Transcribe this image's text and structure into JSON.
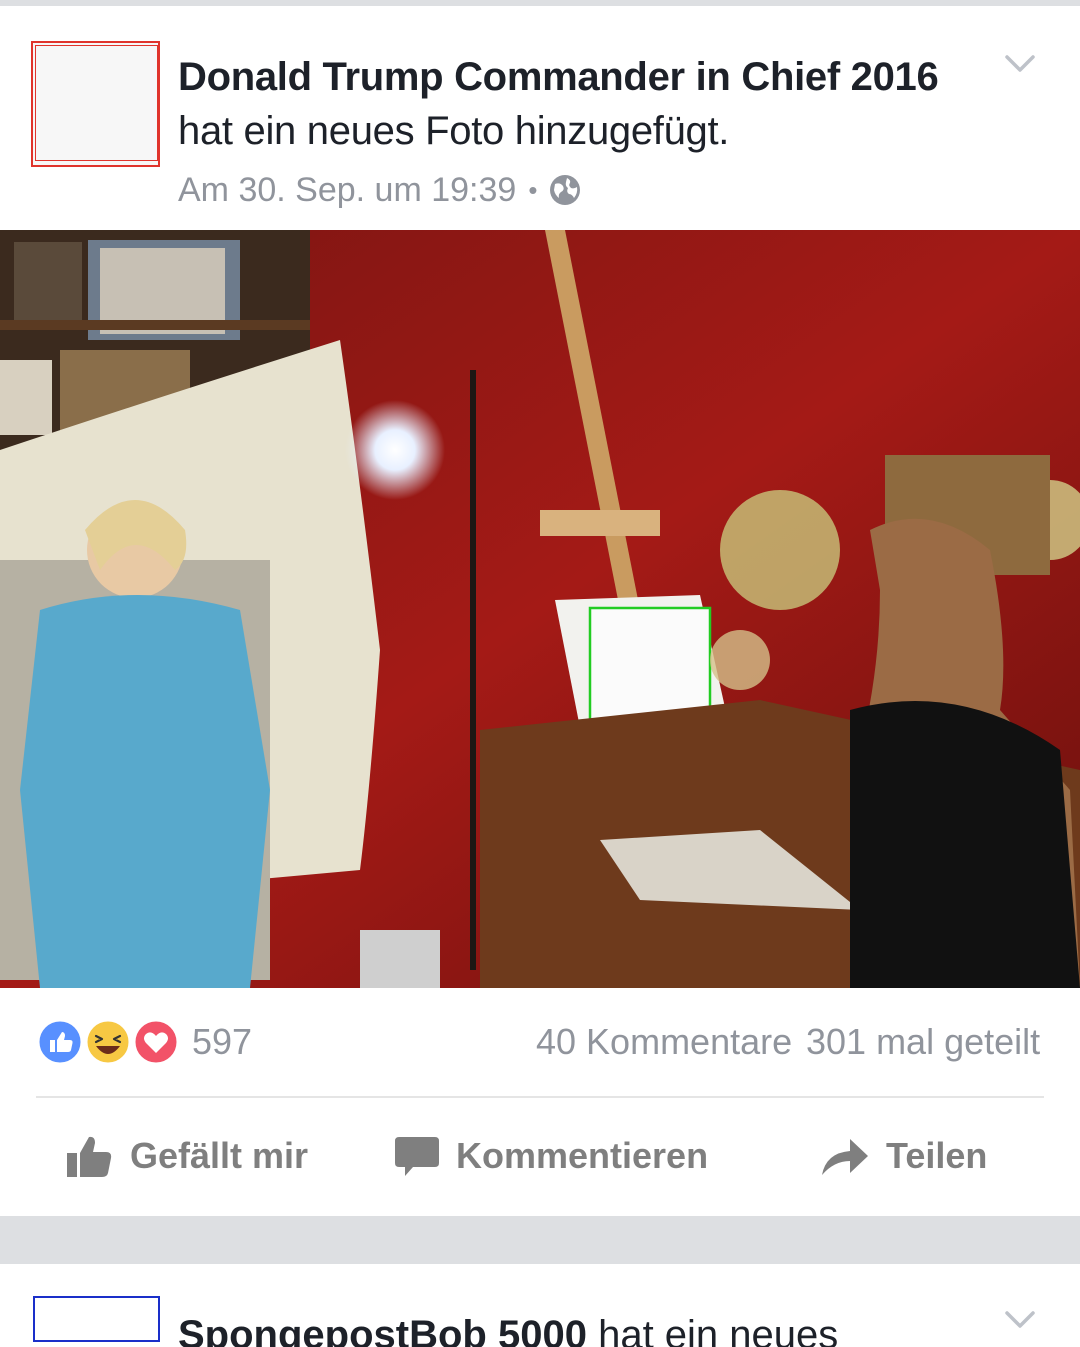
{
  "post": {
    "author": "Donald Trump Commander in Chief 2016",
    "action": "hat ein neues Foto hinzugefügt.",
    "timestamp": "Am 30. Sep. um 19:39",
    "meta_separator": "•",
    "privacy_icon": "globe-icon",
    "menu_icon": "chevron-down-icon"
  },
  "reactions": {
    "icons": [
      "like-icon",
      "haha-icon",
      "love-icon"
    ],
    "count": "597",
    "comments": "40 Kommentare",
    "shares": "301 mal geteilt"
  },
  "actions": {
    "like_label": "Gefällt mir",
    "comment_label": "Kommentieren",
    "share_label": "Teilen"
  },
  "next_post": {
    "author": "SpongepostBob 5000",
    "action": "hat ein neues"
  },
  "colors": {
    "brand_blue": "#4267b2",
    "meta_gray": "#90949c",
    "action_gray": "#7f7f7f",
    "divider_gray": "#dddfe2",
    "annotation_red": "#e0342c",
    "annotation_green": "#22cc22",
    "annotation_blue": "#1a2fc9"
  }
}
